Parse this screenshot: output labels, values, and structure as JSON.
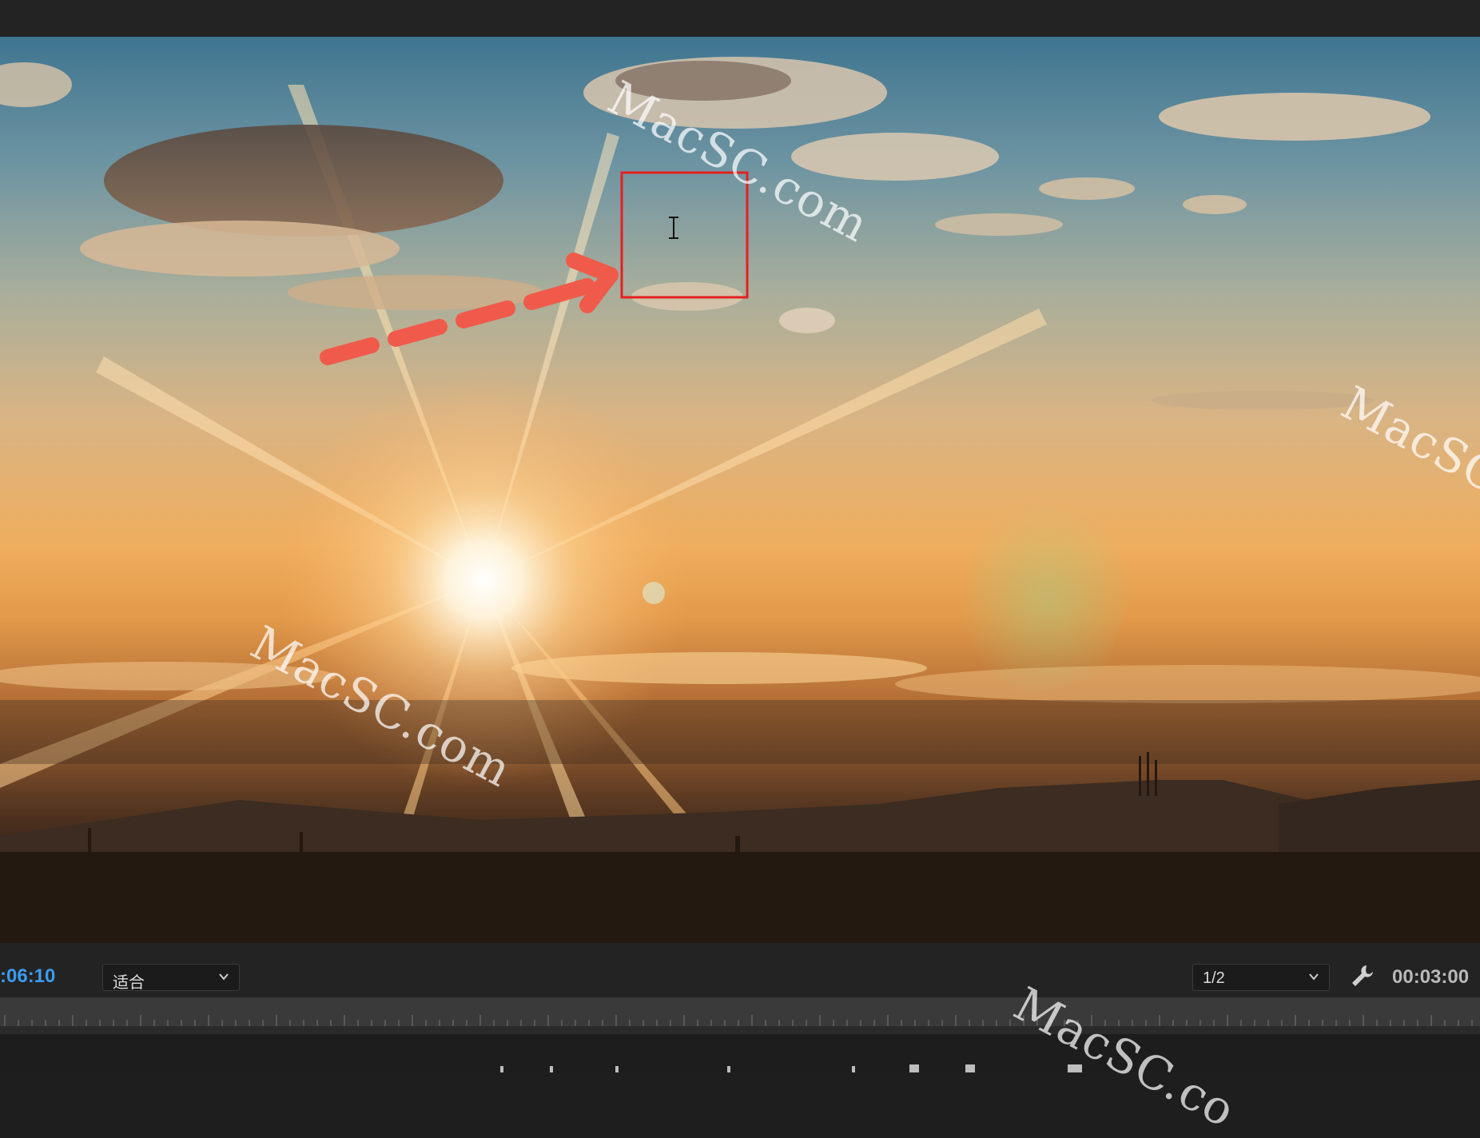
{
  "viewer": {
    "current_time": ":06:10",
    "zoom_level": "适合",
    "resolution": "1/2",
    "duration": "00:03:00"
  },
  "icons": {
    "zoom_dropdown": "chevron-down-icon",
    "resolution_dropdown": "chevron-down-icon",
    "settings": "wrench-icon",
    "cursor": "text-cursor-icon"
  },
  "annotation": {
    "arrow_color": "#f05a4a",
    "box_color": "#e52020"
  },
  "watermarks": [
    "MacSC.com",
    "MacSC.com",
    "MacSC",
    "MacSC.co"
  ],
  "colors": {
    "timecode_accent": "#3b9cf0",
    "panel_bg": "#232323"
  }
}
